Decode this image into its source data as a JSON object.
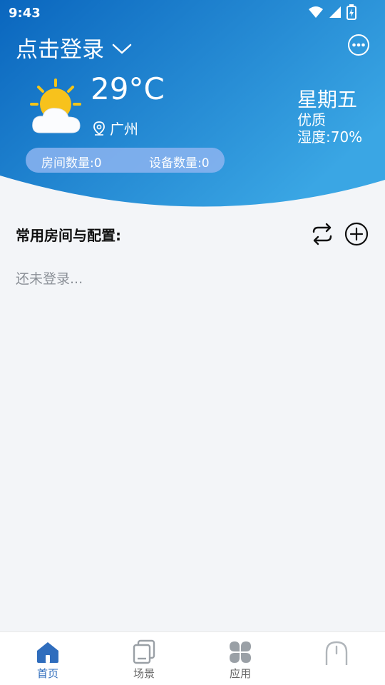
{
  "status_bar": {
    "time": "9:43"
  },
  "header": {
    "login_label": "点击登录",
    "temperature": "29°C",
    "city": "广州",
    "weekday": "星期五",
    "air_quality": "优质",
    "humidity": "湿度:70%",
    "room_count": "房间数量:0",
    "device_count": "设备数量:0"
  },
  "main": {
    "section_title": "常用房间与配置:",
    "empty_text": "还未登录..."
  },
  "tabbar": {
    "tabs": [
      {
        "label": "首页",
        "icon": "home-icon",
        "active": true
      },
      {
        "label": "场景",
        "icon": "scene-icon",
        "active": false
      },
      {
        "label": "应用",
        "icon": "apps-icon",
        "active": false
      },
      {
        "label": "",
        "icon": "profile-icon",
        "active": false
      }
    ]
  },
  "colors": {
    "header_gradient_start": "#0d6fc2",
    "header_gradient_end": "#3aa8e6",
    "accent": "#2f6dbd"
  }
}
